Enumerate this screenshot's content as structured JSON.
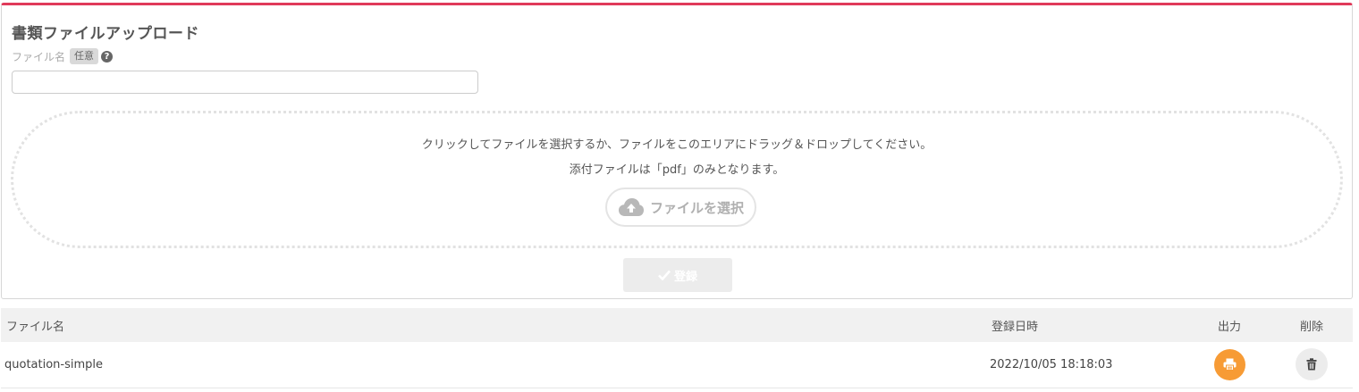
{
  "upload": {
    "title": "書類ファイルアップロード",
    "filename_label": "ファイル名",
    "optional_badge": "任意",
    "help_icon_glyph": "?",
    "filename_value": "",
    "filename_placeholder": "",
    "drop_zone": {
      "instruction": "クリックしてファイルを選択するか、ファイルをこのエリアにドラッグ＆ドロップしてください。",
      "allowed_types": "添付ファイルは「pdf」のみとなります。",
      "select_button_label": "ファイルを選択",
      "select_button_icon": "cloud-upload-icon"
    },
    "register_button_label": "登録",
    "register_button_icon": "check-icon",
    "accent_color": "#e03a5a"
  },
  "table": {
    "headers": {
      "name": "ファイル名",
      "registered_at": "登録日時",
      "output": "出力",
      "delete": "削除"
    },
    "rows": [
      {
        "name": "quotation-simple",
        "registered_at": "2022/10/05 18:18:03",
        "output_icon": "print-icon",
        "delete_icon": "trash-icon"
      }
    ],
    "print_color": "#f79b35"
  }
}
